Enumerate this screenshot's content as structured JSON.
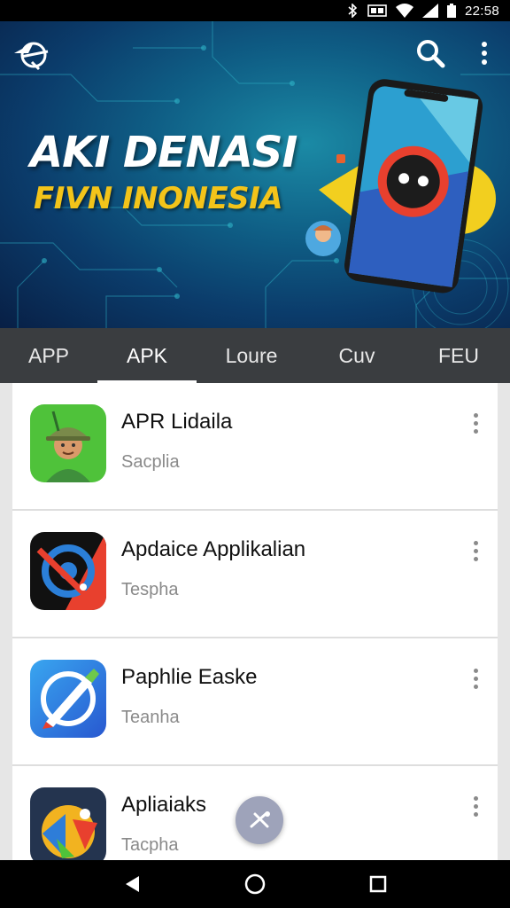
{
  "status_bar": {
    "time": "22:58",
    "icons": [
      "bluetooth-icon",
      "sim-icon",
      "wifi-icon",
      "signal-icon",
      "battery-icon"
    ]
  },
  "banner": {
    "title": "AKI DENASI",
    "subtitle": "FIVN INONESIA",
    "colors": {
      "title": "#ffffff",
      "subtitle": "#f3c41a",
      "bg_dark": "#081f45",
      "bg_light": "#1b8aa5"
    }
  },
  "header_icons": {
    "logo": "app-logo-icon",
    "search": "search-icon",
    "menu": "more-vert-icon"
  },
  "tabs": [
    {
      "label": "APP",
      "active": false
    },
    {
      "label": "APK",
      "active": true
    },
    {
      "label": "Loure",
      "active": false
    },
    {
      "label": "Cuv",
      "active": false
    },
    {
      "label": "FEU",
      "active": false
    }
  ],
  "apps": [
    {
      "name": "APR Lidaila",
      "subtitle": "Sacplia",
      "icon": "explorer-avatar-icon"
    },
    {
      "name": "Apdaice Applikalian",
      "subtitle": "Tespha",
      "icon": "target-app-icon"
    },
    {
      "name": "Paphlie Easke",
      "subtitle": "Teanha",
      "icon": "pen-compass-icon"
    },
    {
      "name": "Apliaiaks",
      "subtitle": "Tacpha",
      "icon": "collage-app-icon"
    }
  ],
  "fab": {
    "icon": "tools-icon"
  },
  "nav": {
    "back": "back-icon",
    "home": "home-icon",
    "recents": "recents-icon"
  }
}
